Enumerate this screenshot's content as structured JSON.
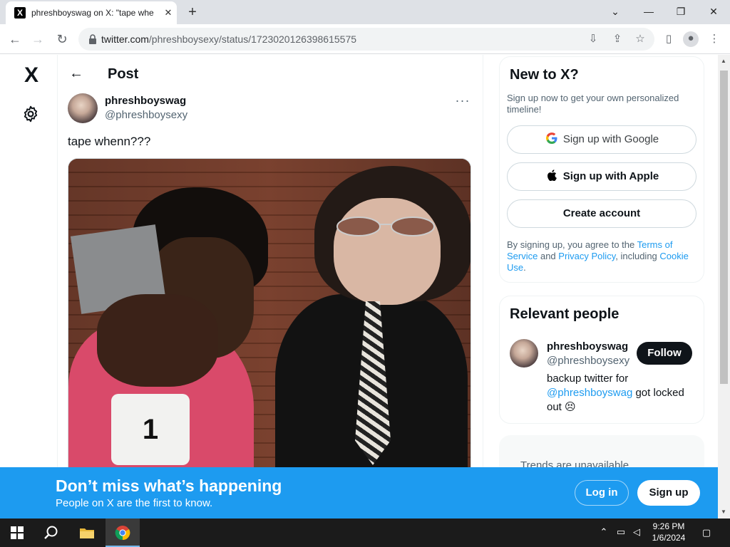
{
  "browser": {
    "tab_title": "phreshboyswag on X: \"tape whenn???\" / X",
    "favicon": "X",
    "tab_close": "✕",
    "new_tab": "+",
    "url_host": "twitter.com",
    "url_path": "/phreshboysexy/status/1723020126398615575",
    "window": {
      "minimize": "—",
      "restore": "❐",
      "close": "✕",
      "dropdown": "⌄"
    }
  },
  "nav": {
    "logo": "X"
  },
  "post": {
    "header_title": "Post",
    "author_name": "phreshboyswag",
    "author_handle": "@phreshboysexy",
    "more": "···",
    "text": "tape whenn???",
    "jersey_number": "1"
  },
  "signup": {
    "title": "New to X?",
    "subtitle": "Sign up now to get your own personalized timeline!",
    "google_label": "Sign up with Google",
    "apple_label": "Sign up with Apple",
    "create_label": "Create account",
    "terms_pre": "By signing up, you agree to the ",
    "terms_link": "Terms of Service",
    "terms_mid": " and ",
    "privacy_link": "Privacy Policy",
    "terms_mid2": ", including ",
    "cookie_link": "Cookie Use",
    "terms_end": "."
  },
  "people": {
    "title": "Relevant people",
    "name": "phreshboyswag",
    "handle": "@phreshboysexy",
    "follow_label": "Follow",
    "bio_pre": "backup twitter for ",
    "bio_link": "@phreshboyswag",
    "bio_post": " got locked out 😣"
  },
  "trends": {
    "text": "Trends are unavailable."
  },
  "banner": {
    "title": "Don’t miss what’s happening",
    "subtitle": "People on X are the first to know.",
    "login_label": "Log in",
    "signup_label": "Sign up"
  },
  "taskbar": {
    "time": "9:26 PM",
    "date": "1/6/2024"
  },
  "colors": {
    "accent": "#1d9bf0",
    "text": "#0f1419",
    "muted": "#536471"
  }
}
